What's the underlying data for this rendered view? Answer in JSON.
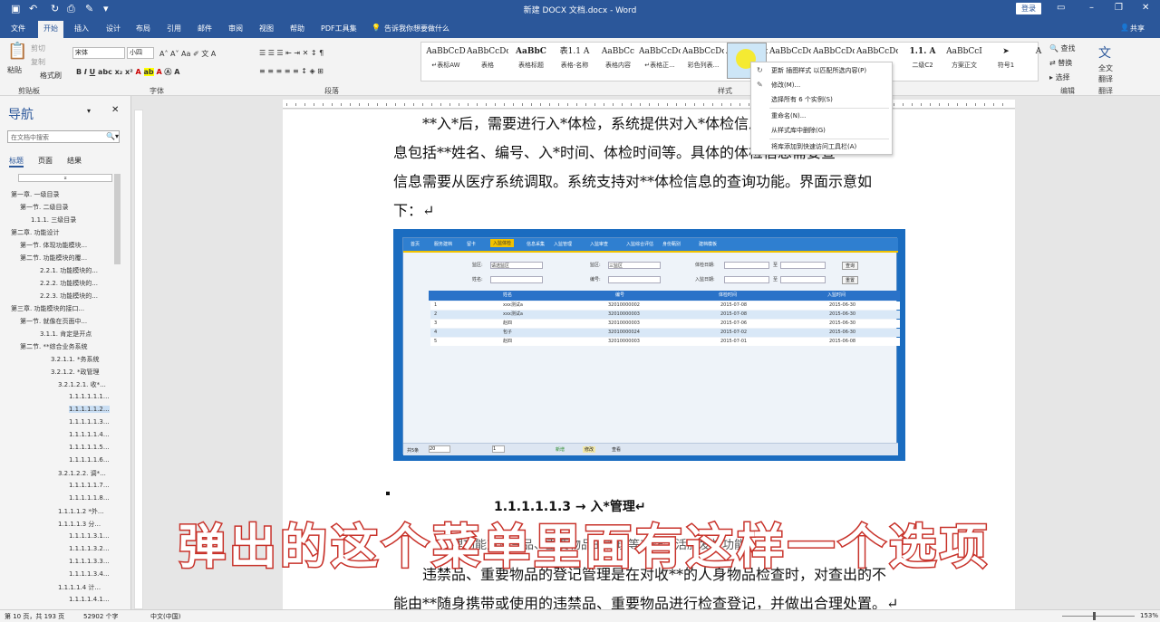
{
  "titlebar": {
    "doc_title": "新建 DOCX 文档.docx - Word",
    "login": "登录"
  },
  "tabs": [
    "文件",
    "开始",
    "插入",
    "设计",
    "布局",
    "引用",
    "邮件",
    "审阅",
    "视图",
    "帮助",
    "PDF工具集"
  ],
  "tell_me": "告诉我你想要做什么",
  "share": "共享",
  "ribbon": {
    "clipboard": {
      "label": "剪贴板",
      "paste": "粘贴",
      "cut": "剪切",
      "copy": "复制",
      "format_painter": "格式刷"
    },
    "font": {
      "label": "字体",
      "name": "宋体",
      "size": "小四"
    },
    "paragraph": {
      "label": "段落"
    },
    "styles": {
      "label": "样式",
      "items": [
        {
          "preview": "AaBbCcD",
          "name": "↵表标AW"
        },
        {
          "preview": "AaBbCcDc",
          "name": "表格"
        },
        {
          "preview": "AaBbC",
          "name": "表格标题"
        },
        {
          "preview": "表1.1 A",
          "name": "表格-名称"
        },
        {
          "preview": "AaBbCc",
          "name": "表格内容"
        },
        {
          "preview": "AaBbCcDc",
          "name": "↵表格正..."
        },
        {
          "preview": "AaBbCcDc",
          "name": "彩色列表..."
        },
        {
          "preview": "AaBbCcDc",
          "name": "插图"
        },
        {
          "preview": "AaBbCcDc",
          "name": ""
        },
        {
          "preview": "AaBbCcDdI",
          "name": ""
        },
        {
          "preview": "AaBbCcDc",
          "name": ""
        },
        {
          "preview": "1.1. A",
          "name": "二级C2"
        },
        {
          "preview": "AaBbCcI",
          "name": "方案正文"
        },
        {
          "preview": "➤",
          "name": "符号1"
        },
        {
          "preview": "A",
          "name": ""
        }
      ]
    },
    "editing": {
      "label": "编辑",
      "find": "查找",
      "replace": "替换",
      "select": "选择"
    },
    "translate": {
      "label": "翻译",
      "full": "全文",
      "full2": "翻译"
    }
  },
  "context_menu": {
    "items": [
      "更新 插图样式 以匹配所选内容(P)",
      "修改(M)...",
      "选择所有 6 个实例(S)",
      "重命名(N)...",
      "从样式库中删除(G)",
      "将库添加到快速访问工具栏(A)"
    ]
  },
  "nav": {
    "title": "导航",
    "search_placeholder": "在文档中搜索",
    "tabs": [
      "标题",
      "页面",
      "结果"
    ],
    "items": [
      "第一章. 一级目录",
      "第一节. 二级目录",
      "1.1.1. 三级目录",
      "第二章. 功能设计",
      "第一节. 体现功能模块...",
      "第二节. 功能模块的覆...",
      "2.2.1. 功能模块的...",
      "2.2.2. 功能模块的...",
      "2.2.3. 功能模块的...",
      "第三章. 功能模块的接口...",
      "第一节. 就像在页面中...",
      "3.1.1. 肯定是开点",
      "第二节. **综合业务系统",
      "3.2.1.1. *务系统",
      "3.2.1.2. *政管理",
      "3.2.1.2.1. 收*...",
      "1.1.1.1.1.1...",
      "1.1.1.1.1.2...",
      "1.1.1.1.1.3...",
      "1.1.1.1.1.4...",
      "1.1.1.1.1.5...",
      "1.1.1.1.1.6...",
      "3.2.1.2.2. 调*...",
      "1.1.1.1.1.7...",
      "1.1.1.1.1.8...",
      "1.1.1.1.2 *外...",
      "1.1.1.1.3 分...",
      "1.1.1.1.3.1...",
      "1.1.1.1.3.2...",
      "1.1.1.1.3.3...",
      "1.1.1.1.3.4...",
      "1.1.1.1.4 计...",
      "1.1.1.1.4.1..."
    ]
  },
  "document": {
    "lines": [
      "**入*后，需要进行入*体检，系统提供对入*体检信息的录入功能，",
      "息包括**姓名、编号、入*时间、体检时间等。具体的体检信息需要查",
      "信息需要从医疗系统调取。系统支持对**体检信息的查询功能。界面示意如",
      "下：↵"
    ],
    "heading": "1.1.1.1.1.3 → 入*管理↵",
    "after_lines": [
      "违禁品、重要物品的登记管理是在对收**的人身物品检查时，对查出的不",
      "能由**随身携带或使用的违禁品、重要物品进行检查登记，并做出合理处置。↵"
    ],
    "partial_line": "理功能对违禁品、重要物品的管理等工作生活服发放功能。↵"
  },
  "embedded_app": {
    "menu": [
      "首页",
      "服务建档",
      "留卡",
      "入监体检",
      "信息采集",
      "入监管理",
      "入监审查",
      "入监综合评估",
      "身份甄别",
      "建档模板"
    ],
    "filters": {
      "l1": "监区:",
      "v1": "请选监区",
      "l2": "监区:",
      "v2": "三监区",
      "l3": "体检日期:",
      "l4": "至",
      "l5": "姓名:",
      "l6": "编号:",
      "l7": "入监日期:",
      "l8": "至",
      "search": "查询",
      "reset": "重置"
    },
    "columns": [
      "姓名",
      "编号",
      "体检时间",
      "入监时间"
    ],
    "rows": [
      [
        "1",
        "xxx测试a",
        "32010000002",
        "2015-07-08",
        "2015-06-30"
      ],
      [
        "2",
        "xxx测试a",
        "32010000003",
        "2015-07-08",
        "2015-06-30"
      ],
      [
        "3",
        "赵四",
        "32010000003",
        "2015-07-06",
        "2015-06-30"
      ],
      [
        "4",
        "包子",
        "32010000024",
        "2015-07-02",
        "2015-06-30"
      ],
      [
        "5",
        "赵四",
        "32010000003",
        "2015-07-01",
        "2015-06-08"
      ]
    ],
    "footer": {
      "total": "共5条",
      "per": "20",
      "page": "1",
      "add": "新增",
      "edit": "修改",
      "view": "查看"
    }
  },
  "status": {
    "page": "第 10 页，共 193 页",
    "words": "52902 个字",
    "lang": "中文(中国)",
    "zoom": "153%"
  },
  "subtitle": "弹出的这个菜单里面有这样一个选项"
}
